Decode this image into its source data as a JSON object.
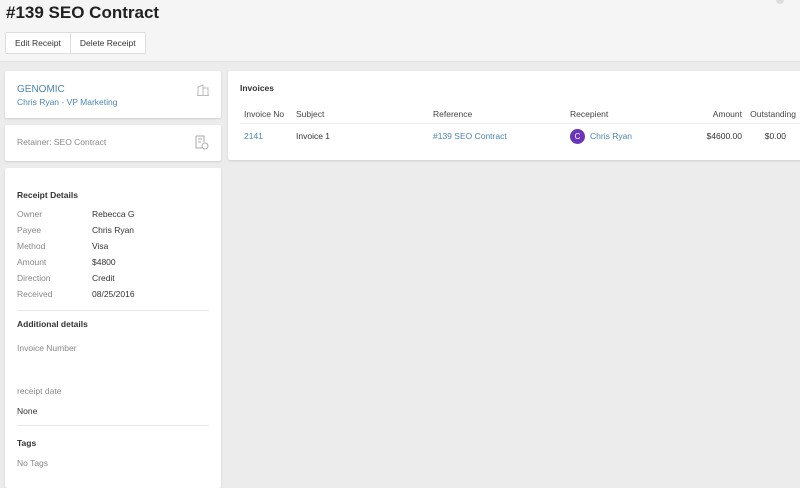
{
  "page": {
    "title": "#139 SEO Contract"
  },
  "toolbar": {
    "edit_label": "Edit Receipt",
    "delete_label": "Delete Receipt"
  },
  "company": {
    "name": "GENOMIC",
    "contact": "Chris Ryan - VP Marketing",
    "icon": "building-icon"
  },
  "retainer": {
    "label": "Retainer: SEO Contract",
    "icon": "document-refresh-icon"
  },
  "receipt_details": {
    "heading": "Receipt Details",
    "fields": [
      {
        "label": "Owner",
        "value": "Rebecca G"
      },
      {
        "label": "Payee",
        "value": "Chris Ryan"
      },
      {
        "label": "Method",
        "value": "Visa"
      },
      {
        "label": "Amount",
        "value": "$4800"
      },
      {
        "label": "Direction",
        "value": "Credit"
      },
      {
        "label": "Received",
        "value": "08/25/2016"
      }
    ]
  },
  "additional": {
    "heading": "Additional details",
    "invoice_number_label": "Invoice Number",
    "receipt_date_label": "receipt date",
    "receipt_date_value": "None"
  },
  "tags": {
    "heading": "Tags",
    "value": "No Tags"
  },
  "invoices": {
    "heading": "Invoices",
    "columns": [
      "Invoice No",
      "Subject",
      "Reference",
      "Recepient",
      "Amount",
      "Outstanding"
    ],
    "rows": [
      {
        "no": "2141",
        "subject": "Invoice 1",
        "reference": "#139 SEO Contract",
        "avatar": "C",
        "recipient": "Chris Ryan",
        "amount": "$4600.00",
        "outstanding": "$0.00"
      }
    ]
  },
  "colors": {
    "link": "#4a86b4",
    "avatar": "#6a35b8"
  }
}
